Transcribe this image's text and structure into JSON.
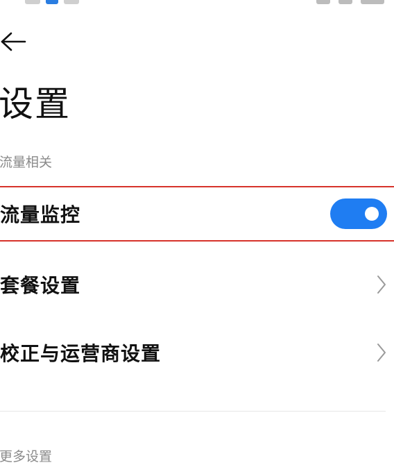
{
  "header": {
    "title": "设置"
  },
  "sections": {
    "traffic": {
      "header": "流量相关",
      "items": [
        {
          "label": "流量监控",
          "toggle_on": true
        },
        {
          "label": "套餐设置"
        },
        {
          "label": "校正与运营商设置"
        }
      ]
    },
    "more": {
      "header": "更多设置"
    }
  },
  "colors": {
    "accent": "#1f7df2",
    "highlight_border": "#d6322a",
    "section_header": "#8a8a8a"
  },
  "icons": {
    "back": "arrow-left-icon",
    "chevron": "chevron-right-icon"
  }
}
